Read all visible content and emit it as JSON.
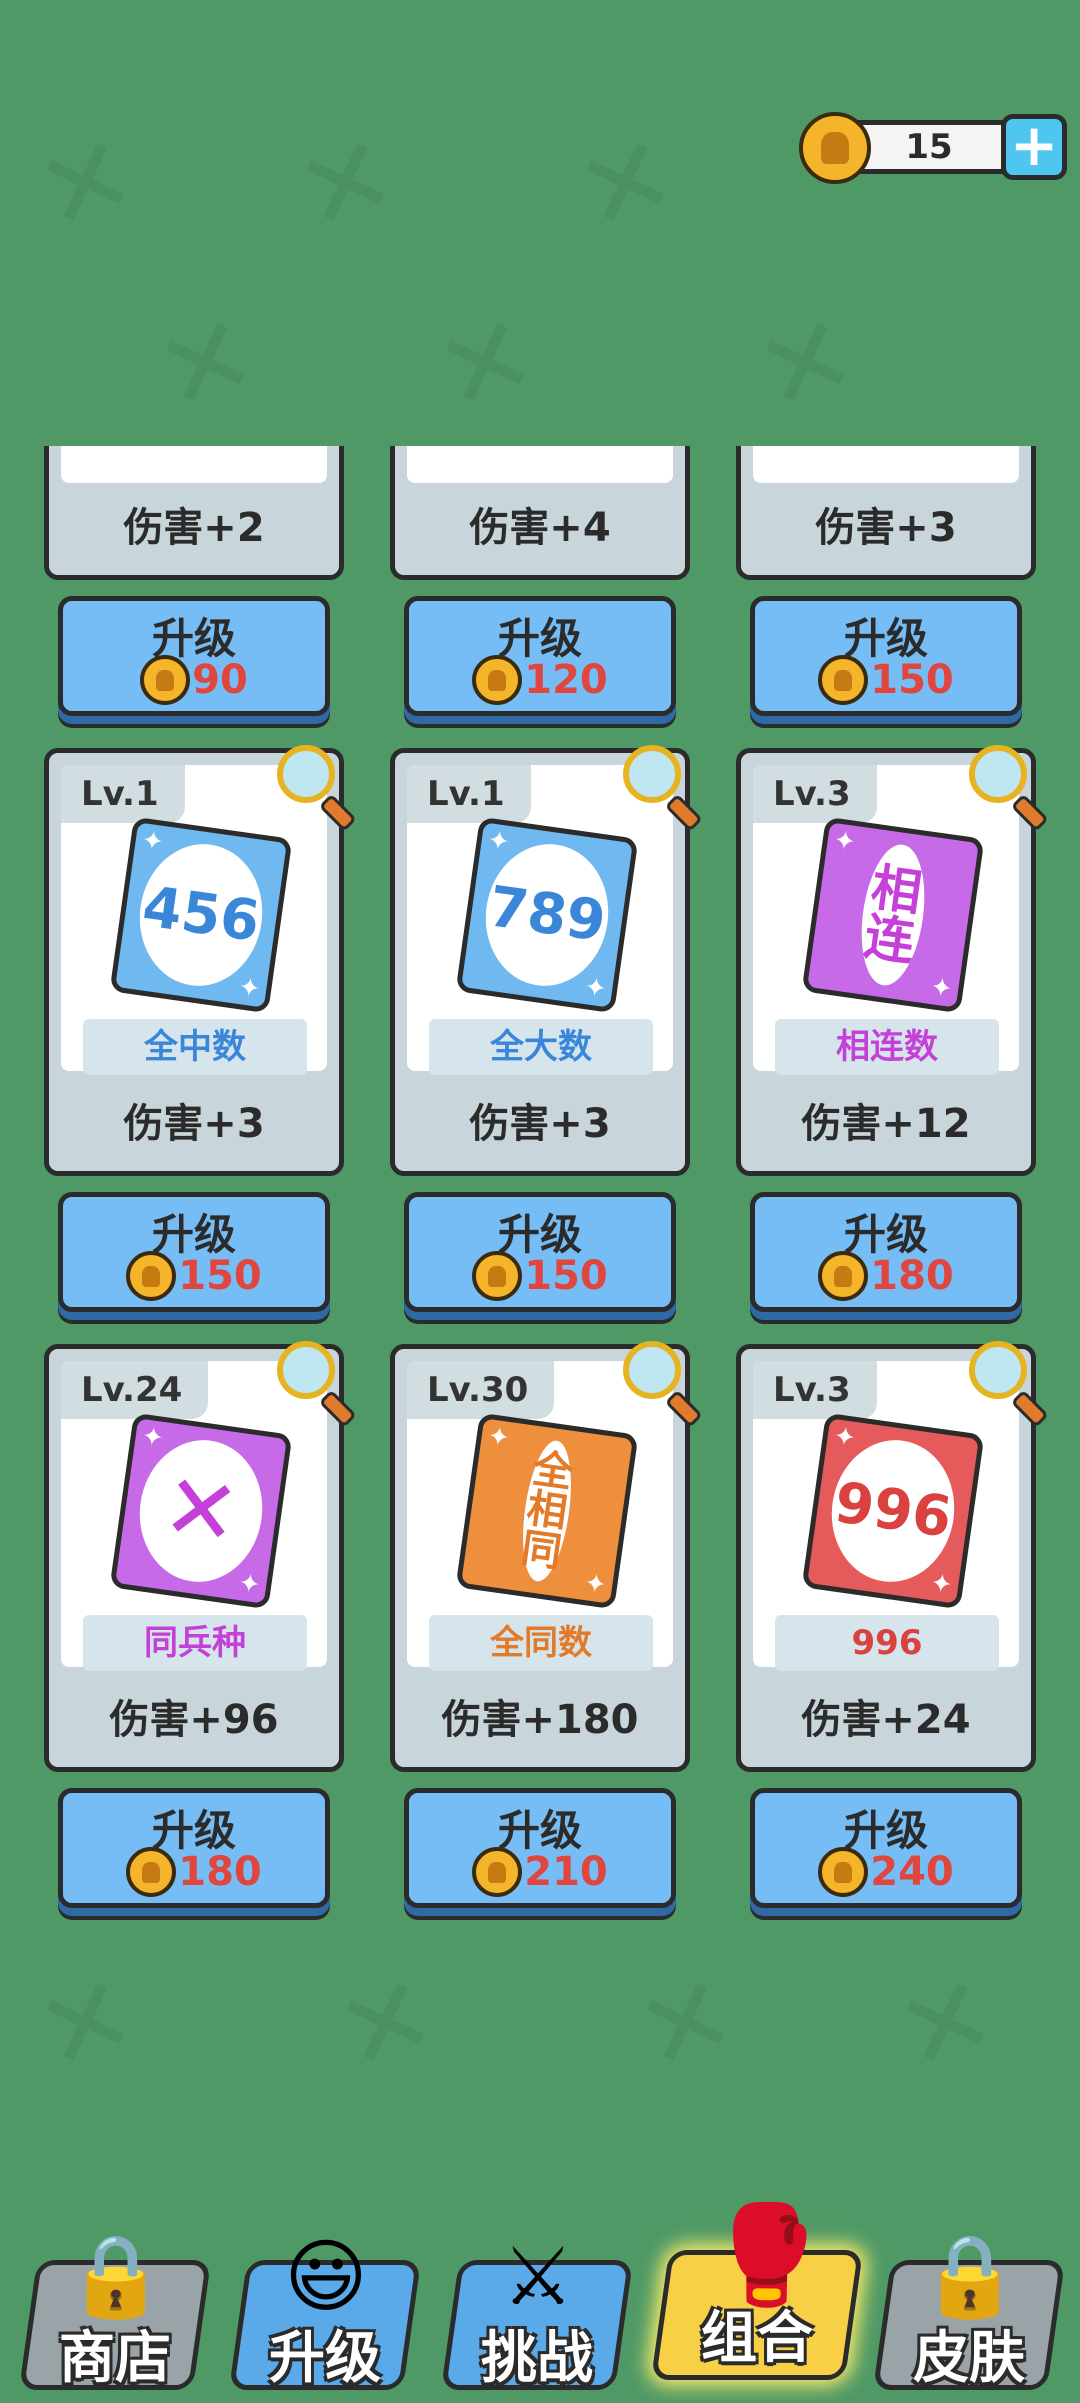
{
  "currency": {
    "amount": "15",
    "icon": "helmet-coin-icon",
    "add_icon": "plus-icon"
  },
  "top_row": [
    {
      "damage": "伤害+2",
      "upgrade_label": "升级",
      "cost": "90"
    },
    {
      "damage": "伤害+4",
      "upgrade_label": "升级",
      "cost": "120"
    },
    {
      "damage": "伤害+3",
      "upgrade_label": "升级",
      "cost": "150"
    }
  ],
  "cards": [
    {
      "level": "Lv.1",
      "art": "456",
      "name": "全中数",
      "damage": "伤害+3",
      "upgrade_label": "升级",
      "cost": "150",
      "color": "#6fb8f0",
      "text_color": "#3a86d8"
    },
    {
      "level": "Lv.1",
      "art": "789",
      "name": "全大数",
      "damage": "伤害+3",
      "upgrade_label": "升级",
      "cost": "150",
      "color": "#6fb8f0",
      "text_color": "#3a86d8"
    },
    {
      "level": "Lv.3",
      "art": "相连",
      "name": "相连数",
      "damage": "伤害+12",
      "upgrade_label": "升级",
      "cost": "180",
      "color": "#c76ae8",
      "text_color": "#c540d8"
    },
    {
      "level": "Lv.24",
      "art": "swords-icon",
      "name": "同兵种",
      "damage": "伤害+96",
      "upgrade_label": "升级",
      "cost": "180",
      "color": "#c76ae8",
      "text_color": "#c540d8"
    },
    {
      "level": "Lv.30",
      "art": "全相同",
      "name": "全同数",
      "damage": "伤害+180",
      "upgrade_label": "升级",
      "cost": "210",
      "color": "#ee8f3d",
      "text_color": "#e27a2a"
    },
    {
      "level": "Lv.3",
      "art": "996",
      "name": "996",
      "damage": "伤害+24",
      "upgrade_label": "升级",
      "cost": "240",
      "color": "#e55a5a",
      "text_color": "#d9423e"
    }
  ],
  "nav": [
    {
      "label": "商店",
      "icon": "locked-shop-icon",
      "bg": "#9aa3a8"
    },
    {
      "label": "升级",
      "icon": "upgrade-mascot-icon",
      "bg": "#5aa9e8"
    },
    {
      "label": "挑战",
      "icon": "crossed-swords-icon",
      "bg": "#5aa9e8"
    },
    {
      "label": "组合",
      "icon": "boxing-gloves-icon",
      "bg": "#f7d046"
    },
    {
      "label": "皮肤",
      "icon": "locked-cards-icon",
      "bg": "#9aa3a8"
    }
  ]
}
